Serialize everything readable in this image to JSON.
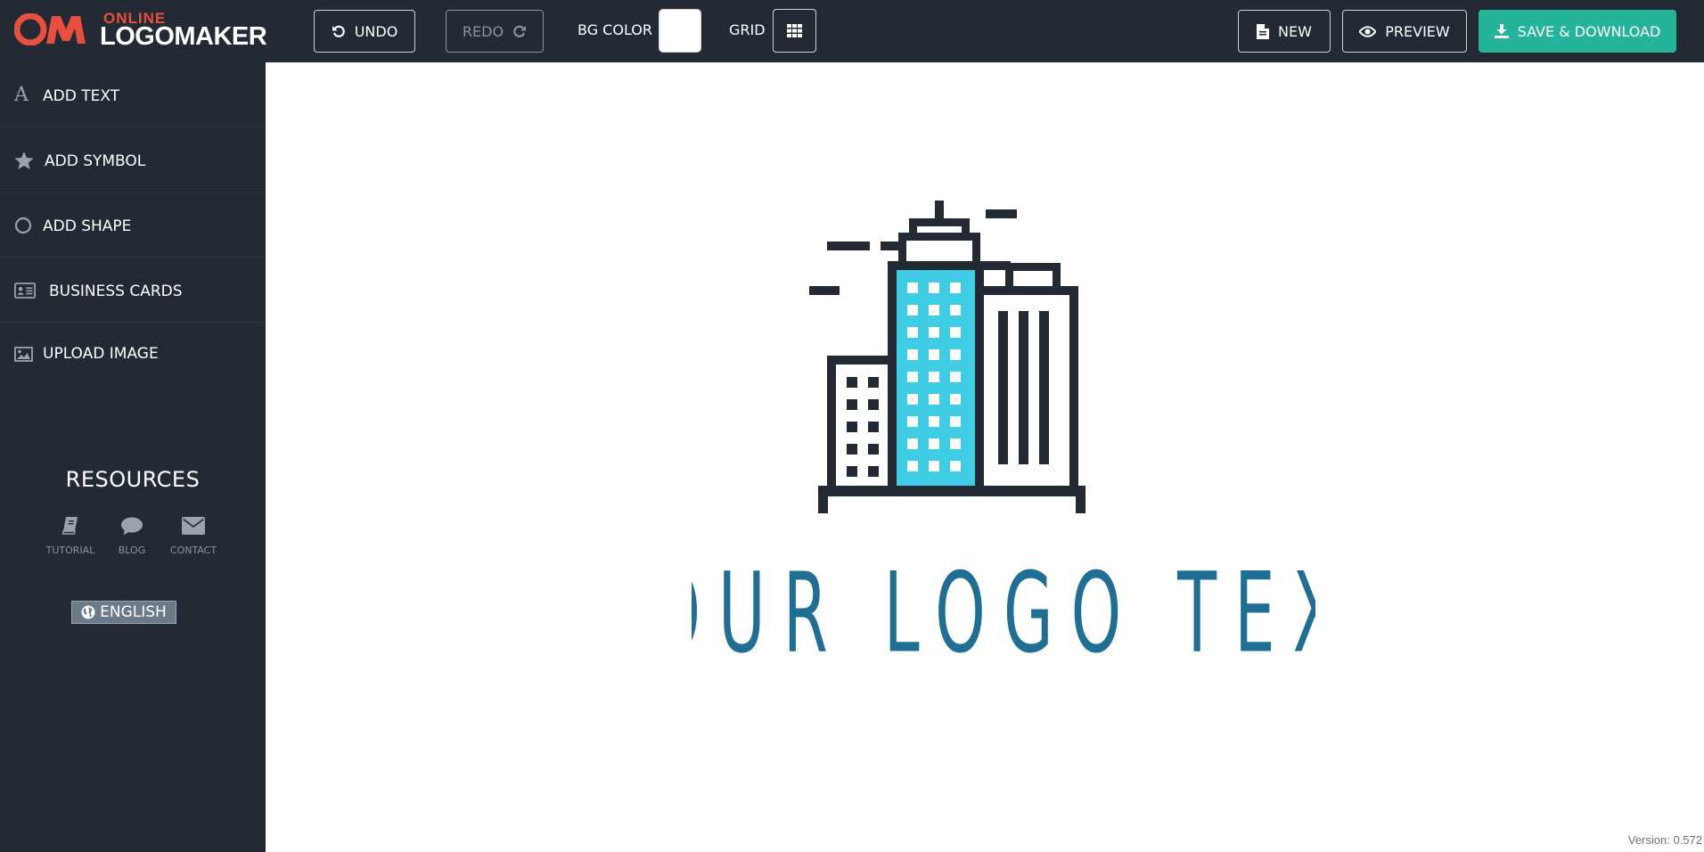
{
  "brand": {
    "logo_online": "ONLINE",
    "logo_maker": "LOGOMAKER",
    "accent": "#e8503e"
  },
  "toolbar": {
    "undo": "UNDO",
    "redo": "REDO",
    "bg_color_label": "BG COLOR",
    "bg_color_value": "#ffffff",
    "grid_label": "GRID",
    "new": "NEW",
    "preview": "PREVIEW",
    "save": "SAVE & DOWNLOAD",
    "save_color": "#24b39b",
    "bar_color": "#232a33"
  },
  "sidebar": {
    "items": [
      {
        "label": "ADD TEXT",
        "icon": "text-icon"
      },
      {
        "label": "ADD SYMBOL",
        "icon": "star-icon"
      },
      {
        "label": "ADD SHAPE",
        "icon": "circle-icon"
      },
      {
        "label": "BUSINESS CARDS",
        "icon": "id-card-icon"
      },
      {
        "label": "UPLOAD IMAGE",
        "icon": "image-icon"
      }
    ],
    "resources_title": "RESOURCES",
    "resources": [
      {
        "label": "TUTORIAL",
        "icon": "book-icon"
      },
      {
        "label": "BLOG",
        "icon": "comment-icon"
      },
      {
        "label": "CONTACT",
        "icon": "envelope-icon"
      }
    ],
    "language": "ENGLISH"
  },
  "canvas": {
    "logo_text": "YOUR LOGO TEXT",
    "text_color": "#1f6f95",
    "building_dark": "#232a33",
    "building_accent": "#3fcde5",
    "version": "Version: 0.572"
  }
}
